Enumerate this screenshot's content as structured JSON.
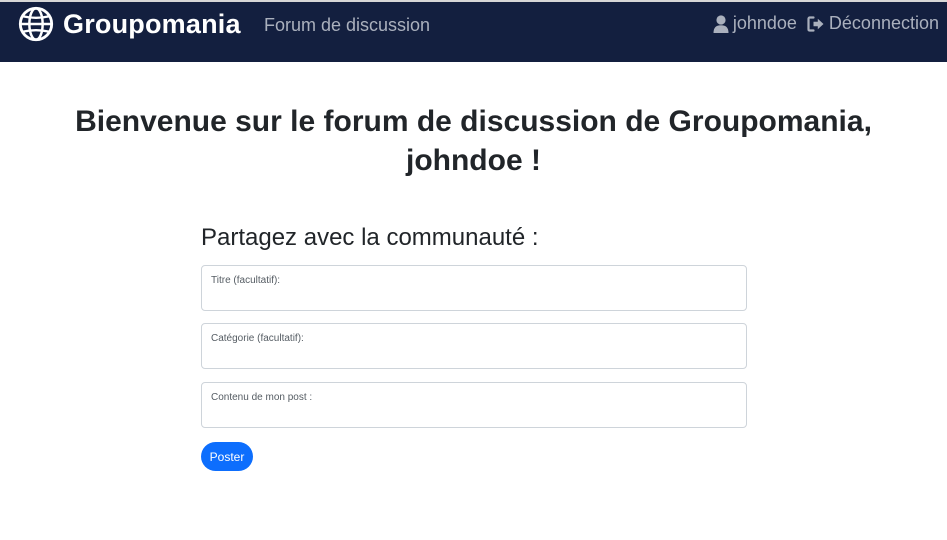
{
  "navbar": {
    "brand_name": "Groupomania",
    "forum_link": "Forum de discussion",
    "username": "johndoe",
    "logout_label": "Déconnection",
    "background_color": "#131f3f",
    "brand_icon": "globe-icon",
    "user_icon": "user-icon",
    "logout_icon": "sign-out-icon"
  },
  "main": {
    "welcome_line1": "Bienvenue sur le forum de discussion de Groupomania,",
    "welcome_line2": "johndoe !",
    "share_title": "Partagez avec la communauté :",
    "fields": {
      "title_label": "Titre (facultatif):",
      "title_value": "",
      "category_label": "Catégorie (facultatif):",
      "category_value": "",
      "content_label": "Contenu de mon post :",
      "content_value": ""
    },
    "post_button": "Poster",
    "accent_color": "#0d6efd"
  }
}
